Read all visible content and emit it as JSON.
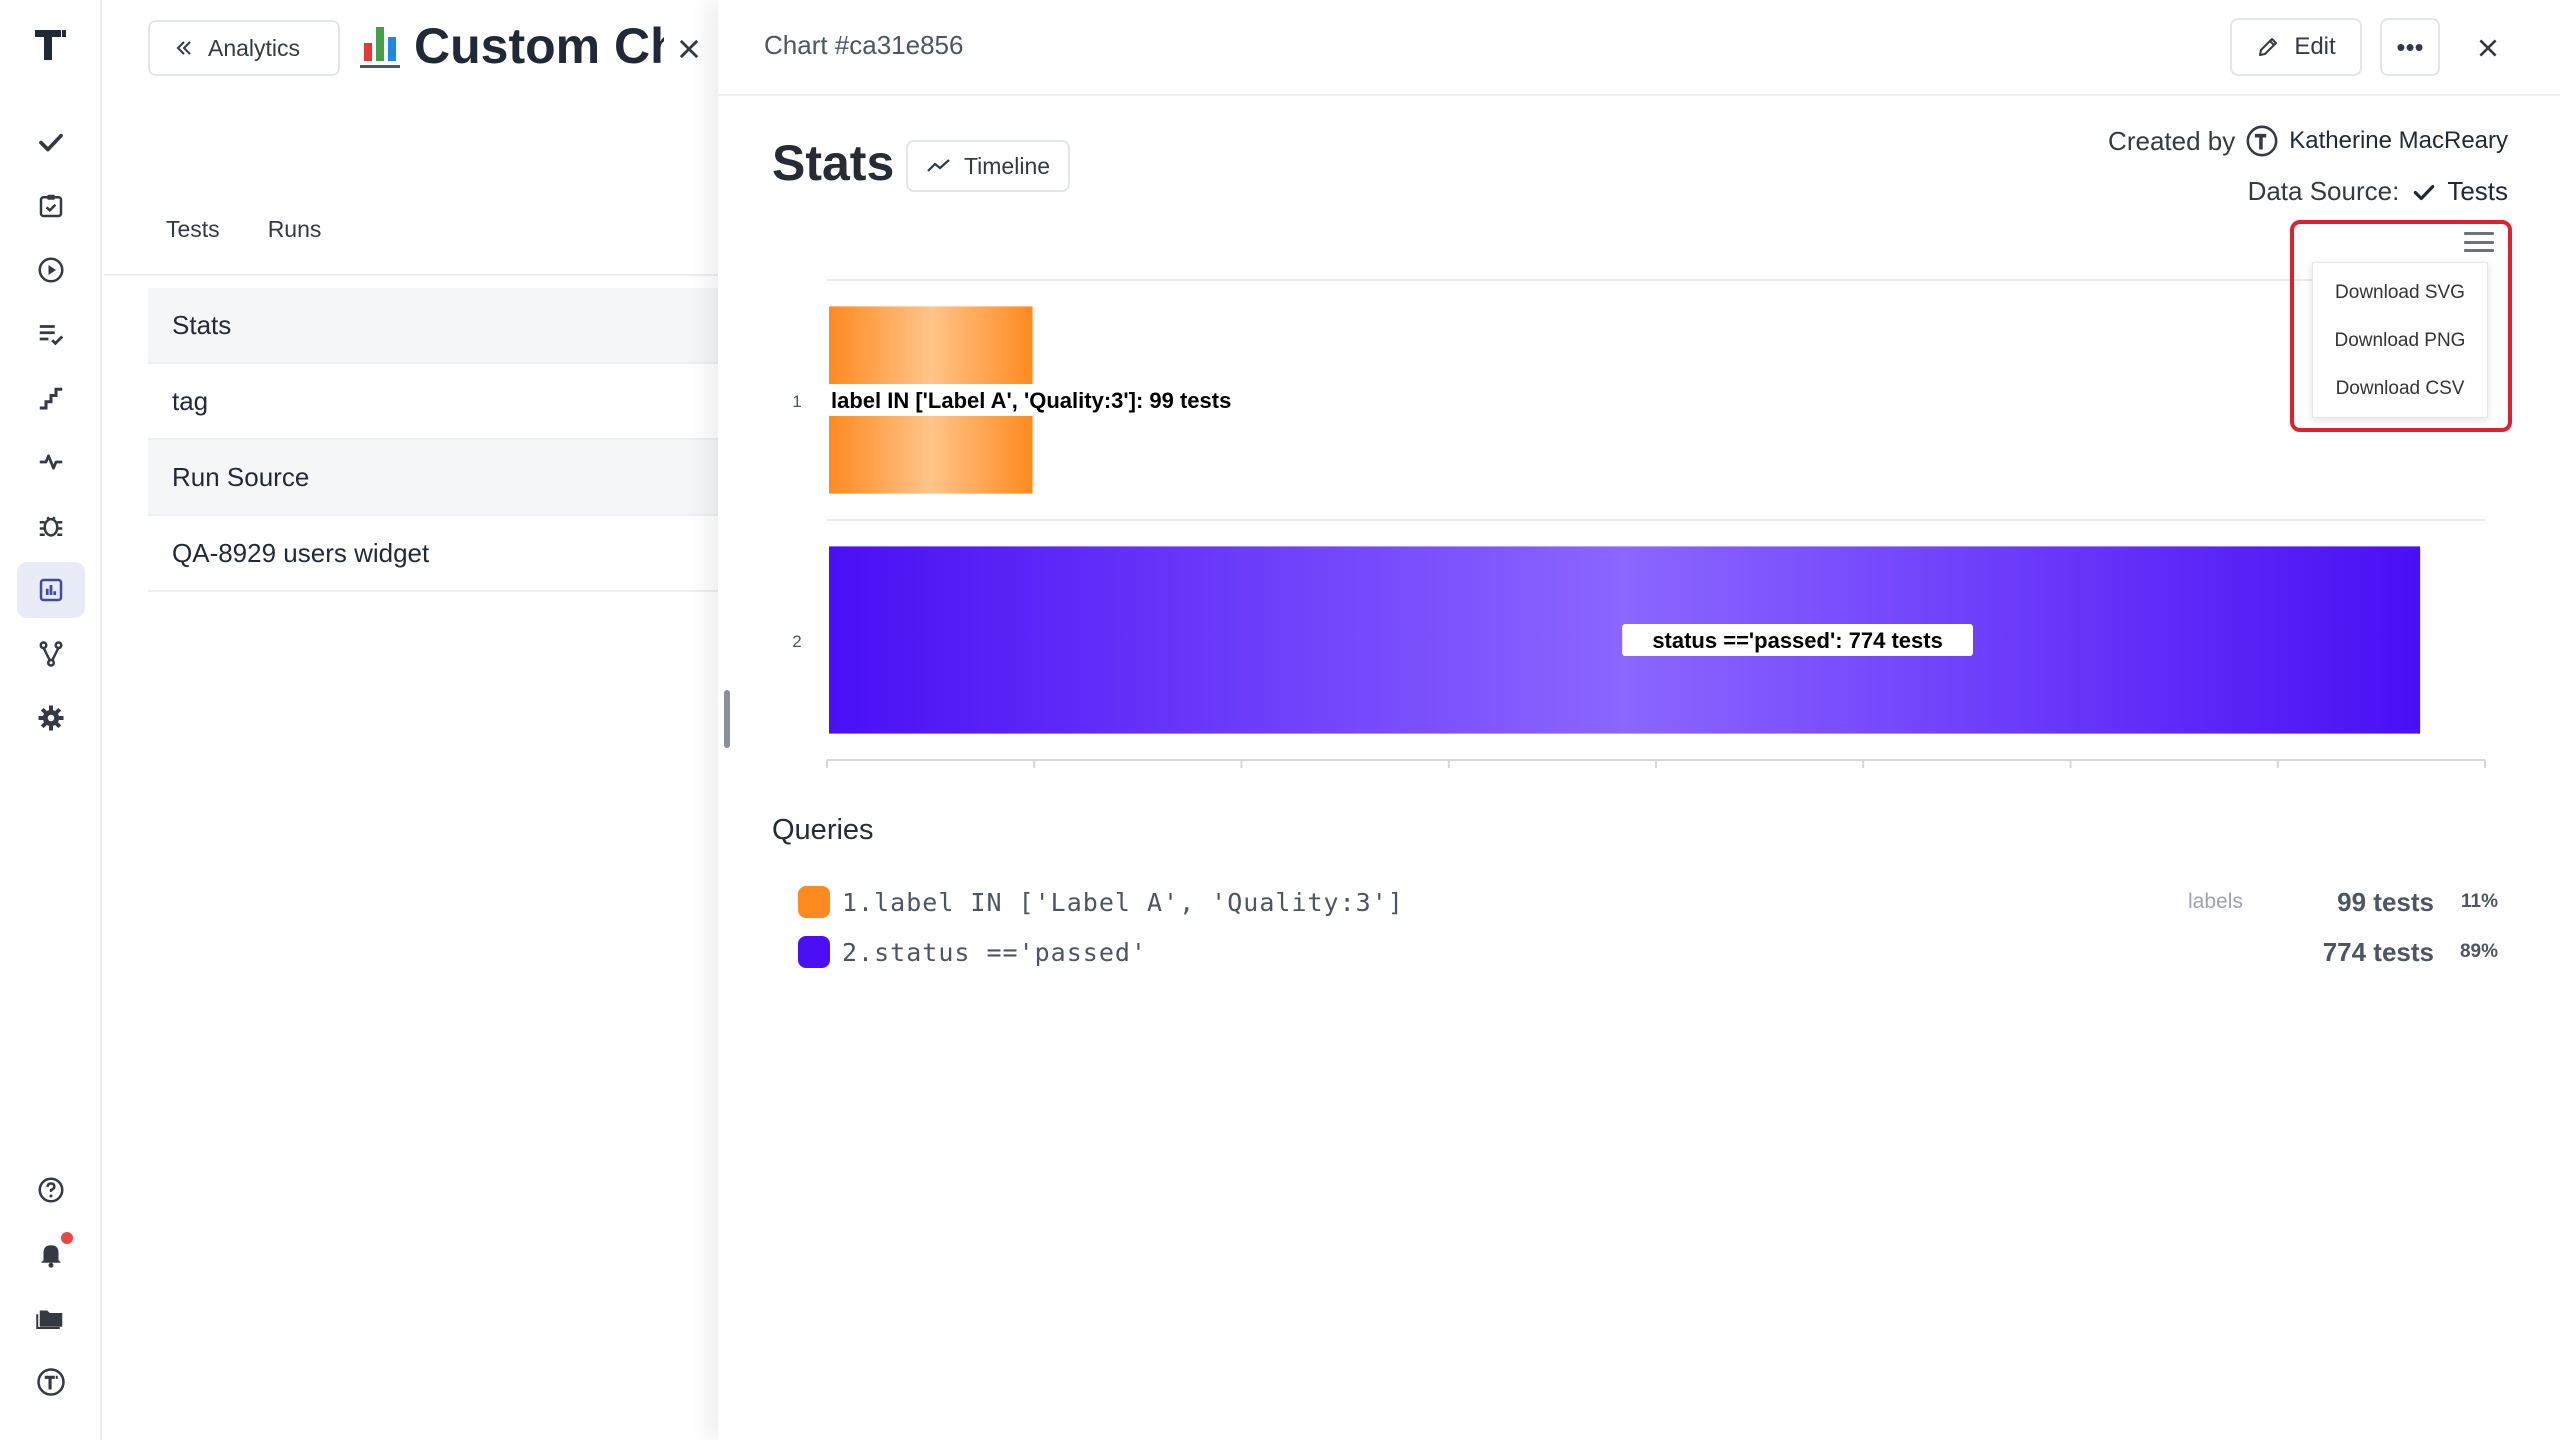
{
  "nav": {
    "items": [
      {
        "name": "tests",
        "icon": "check-icon"
      },
      {
        "name": "plans",
        "icon": "clipboard-check-icon"
      },
      {
        "name": "runs",
        "icon": "play-circle-icon"
      },
      {
        "name": "requirements",
        "icon": "list-check-icon"
      },
      {
        "name": "steps",
        "icon": "stairs-icon"
      },
      {
        "name": "pulse",
        "icon": "pulse-icon"
      },
      {
        "name": "defects",
        "icon": "bug-icon"
      },
      {
        "name": "analytics",
        "icon": "bar-chart-icon",
        "active": true
      },
      {
        "name": "branches",
        "icon": "git-branch-icon"
      },
      {
        "name": "settings",
        "icon": "gear-icon"
      }
    ],
    "bottom": [
      {
        "name": "help",
        "icon": "help-circle-icon"
      },
      {
        "name": "notifications",
        "icon": "bell-icon",
        "badge": true
      },
      {
        "name": "projects",
        "icon": "folder-icon"
      },
      {
        "name": "account",
        "icon": "logo-circle-icon"
      }
    ]
  },
  "page": {
    "back_label": "Analytics",
    "title": "Custom Ch",
    "tabs": [
      "Tests",
      "Runs"
    ],
    "list": [
      "Stats",
      "tag",
      "Run Source",
      "QA-8929 users widget"
    ]
  },
  "panel": {
    "title": "Chart #ca31e856",
    "edit_label": "Edit",
    "more_label": "•••",
    "heading": "Stats",
    "view_label": "Timeline",
    "created_by_label": "Created by",
    "author": "Katherine MacReary",
    "data_source_label": "Data Source:",
    "data_source_value": "Tests",
    "export_menu": [
      "Download SVG",
      "Download PNG",
      "Download CSV"
    ],
    "queries_title": "Queries",
    "queries": [
      {
        "index": "1.",
        "query": "label IN ['Label A', 'Quality:3']",
        "tag": "labels",
        "count": "99 tests",
        "percent": "11%",
        "color": "#ff8a1f"
      },
      {
        "index": "2.",
        "query": "status =='passed'",
        "tag": "",
        "count": "774 tests",
        "percent": "89%",
        "color": "#4a0ff5"
      }
    ]
  },
  "colors": {
    "accent": "#4a0ff5",
    "orange": "#ff8a1f",
    "highlight_red": "#e0202e",
    "active_nav": "#e8ecf7"
  },
  "chart_data": {
    "type": "bar",
    "orientation": "horizontal",
    "categories": [
      "1",
      "2"
    ],
    "values": [
      99,
      774
    ],
    "data_labels": [
      "label IN ['Label A', 'Quality:3']: 99 tests",
      "status =='passed': 774 tests"
    ],
    "colors": [
      "#ff8a1f",
      "#4a0ff5"
    ],
    "xlim": [
      0,
      790
    ],
    "grid": true,
    "legend": "none"
  }
}
